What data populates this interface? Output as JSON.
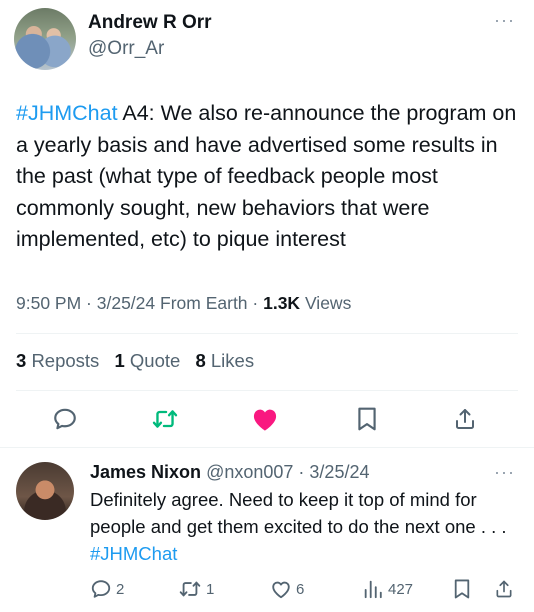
{
  "tweet": {
    "author_name": "Andrew R Orr",
    "author_handle": "@Orr_Ar",
    "more_label": "···",
    "hashtag": "#JHMChat",
    "body": " A4: We also re-announce the program on a yearly basis and have advertised some results in the past (what type of feedback people most commonly sought, new behaviors that were implemented, etc) to pique interest",
    "time": "9:50 PM",
    "date": "3/25/24",
    "source": "From Earth",
    "views_count": "1.3K",
    "views_label": "Views",
    "reposts_count": "3",
    "reposts_label": "Reposts",
    "quotes_count": "1",
    "quotes_label": "Quote",
    "likes_count": "8",
    "likes_label": "Likes",
    "liked": true,
    "colors": {
      "like": "#f91880",
      "retweet": "#00ba7c",
      "link": "#1d9bf0"
    }
  },
  "reply": {
    "author_name": "James Nixon",
    "author_handle": "@nxon007",
    "date": "3/25/24",
    "more_label": "···",
    "body": "Definitely agree.  Need to keep it top of mind for people and get them excited to do the next one . . . ",
    "hashtag": "#JHMChat",
    "replies": "2",
    "reposts": "1",
    "likes": "6",
    "views": "427"
  }
}
